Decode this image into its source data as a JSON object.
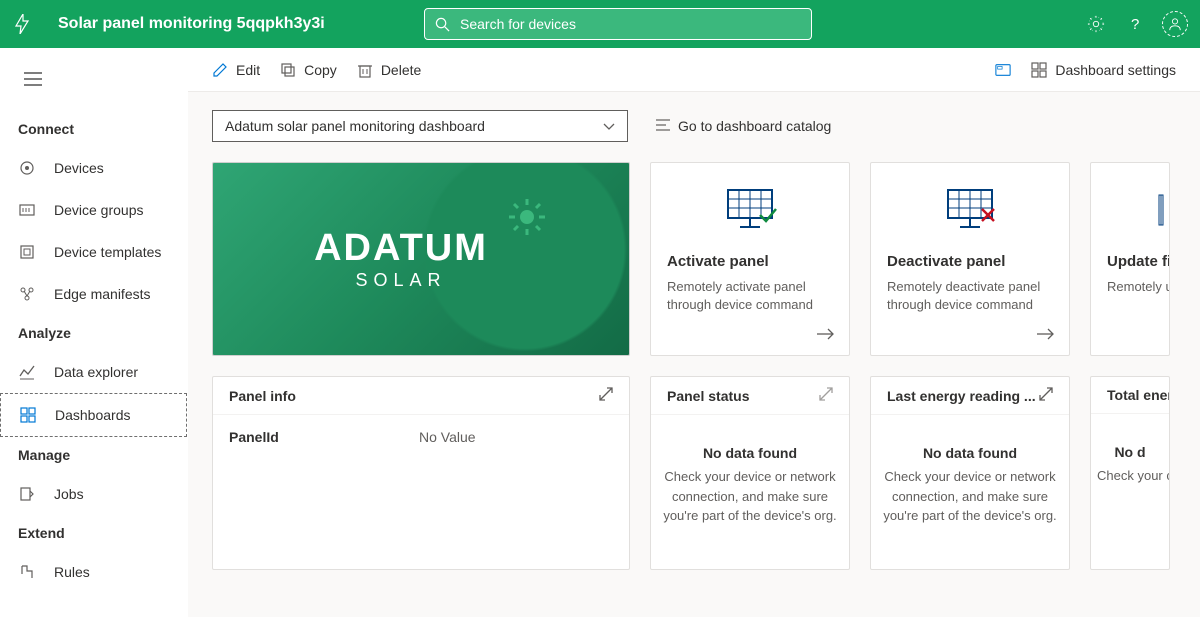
{
  "header": {
    "app_title": "Solar panel monitoring 5qqpkh3y3i",
    "search_placeholder": "Search for devices"
  },
  "sidebar": {
    "sections": [
      {
        "title": "Connect",
        "items": [
          {
            "id": "devices",
            "label": "Devices"
          },
          {
            "id": "device-groups",
            "label": "Device groups"
          },
          {
            "id": "device-templates",
            "label": "Device templates"
          },
          {
            "id": "edge-manifests",
            "label": "Edge manifests"
          }
        ]
      },
      {
        "title": "Analyze",
        "items": [
          {
            "id": "data-explorer",
            "label": "Data explorer"
          },
          {
            "id": "dashboards",
            "label": "Dashboards",
            "active": true
          }
        ]
      },
      {
        "title": "Manage",
        "items": [
          {
            "id": "jobs",
            "label": "Jobs"
          }
        ]
      },
      {
        "title": "Extend",
        "items": [
          {
            "id": "rules",
            "label": "Rules"
          }
        ]
      }
    ]
  },
  "toolbar": {
    "edit": "Edit",
    "copy": "Copy",
    "delete": "Delete",
    "dashboard_settings": "Dashboard settings"
  },
  "dashboard": {
    "selector_label": "Adatum solar panel monitoring dashboard",
    "catalog_link": "Go to dashboard catalog",
    "hero": {
      "brand": "ADATUM",
      "sub": "SOLAR"
    },
    "tiles": {
      "activate": {
        "title": "Activate panel",
        "desc": "Remotely activate panel through device command"
      },
      "deactivate": {
        "title": "Deactivate panel",
        "desc": "Remotely deactivate panel through device command"
      },
      "update_fw": {
        "title": "Update fir",
        "desc": "Remotely up through dev"
      },
      "panel_info": {
        "title": "Panel info",
        "key": "PanelId",
        "value": "No Value"
      },
      "panel_status": {
        "title": "Panel status"
      },
      "last_energy": {
        "title": "Last energy reading ..."
      },
      "total_energy": {
        "title": "Total ener"
      }
    },
    "no_data": {
      "title": "No data found",
      "desc": "Check your device or network connection, and make sure you're part of the device's org.",
      "title_partial": "No d",
      "desc_partial": "Check your connection, a part of th"
    }
  }
}
